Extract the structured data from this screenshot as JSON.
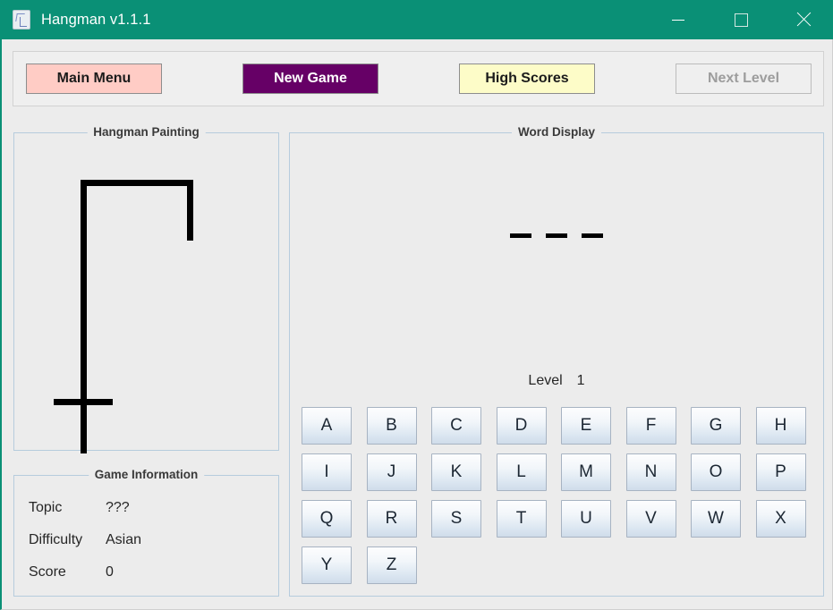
{
  "window": {
    "title": "Hangman v1.1.1",
    "icon": "app-document-icon",
    "titlebar_color": "#0a9076",
    "minimize_label": "",
    "maximize_label": "",
    "close_label": ""
  },
  "toolbar": {
    "main_menu_label": "Main Menu",
    "main_menu_color": "#ffccc5",
    "new_game_label": "New Game",
    "new_game_color": "#660066",
    "high_scores_label": "High Scores",
    "high_scores_color": "#fdfcc8",
    "next_level_label": "Next Level",
    "next_level_enabled": "false"
  },
  "painting": {
    "legend": "Hangman Painting",
    "parts_drawn": "gallows only"
  },
  "game_information": {
    "legend": "Game Information",
    "rows": [
      {
        "label": "Topic",
        "value": "???"
      },
      {
        "label": "Difficulty",
        "value": "Asian"
      },
      {
        "label": "Score",
        "value": "0"
      }
    ]
  },
  "word_display": {
    "legend": "Word Display",
    "slots": [
      "_",
      "_",
      "_"
    ],
    "word_length": 3,
    "level_label": "Level",
    "level_value": "1"
  },
  "keyboard": {
    "keys": [
      "A",
      "B",
      "C",
      "D",
      "E",
      "F",
      "G",
      "H",
      "I",
      "J",
      "K",
      "L",
      "M",
      "N",
      "O",
      "P",
      "Q",
      "R",
      "S",
      "T",
      "U",
      "V",
      "W",
      "X",
      "Y",
      "Z"
    ]
  }
}
